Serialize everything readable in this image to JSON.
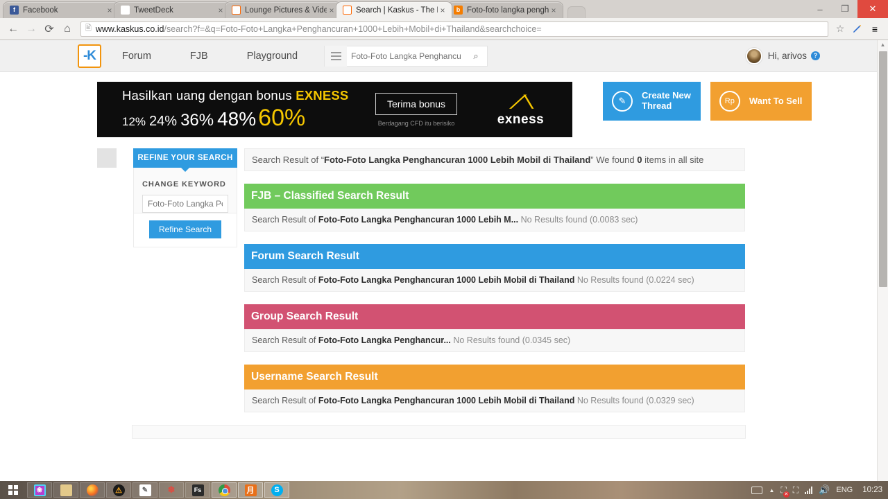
{
  "browser": {
    "tabs": [
      {
        "title": "Facebook",
        "favicon": "facebook-icon",
        "glyph": "f",
        "active": false
      },
      {
        "title": "TweetDeck",
        "favicon": "twitter-icon",
        "glyph": "▼",
        "active": false
      },
      {
        "title": "Lounge Pictures & Video",
        "favicon": "kaskus-icon",
        "glyph": "K",
        "active": false
      },
      {
        "title": "Search | Kaskus - The Larg",
        "favicon": "kaskus-icon",
        "glyph": "K",
        "active": true
      },
      {
        "title": "Foto-foto langka penghan",
        "favicon": "blogger-icon",
        "glyph": "b",
        "active": false
      }
    ],
    "tab_close_label": "×",
    "window": {
      "minimize": "–",
      "restore": "❐",
      "close": "✕"
    },
    "nav": {
      "back": "←",
      "forward": "→",
      "reload": "⟳",
      "home": "⌂"
    },
    "url_host": "www.kaskus.co.id",
    "url_path": "/search?f=&q=Foto-Foto+Langka+Penghancuran+1000+Lebih+Mobil+di+Thailand&searchchoice=",
    "page_icon": "὜B",
    "bookmark_icon": "☆",
    "edit_icon": "✎",
    "menu_icon": "≡"
  },
  "site_header": {
    "logo_text": "-K",
    "nav": [
      {
        "label": "Forum"
      },
      {
        "label": "FJB"
      },
      {
        "label": "Playground"
      }
    ],
    "search_value": "Foto-Foto Langka Penghancur",
    "search_placeholder": "Foto-Foto Langka Penghancur",
    "search_icon": "⌕",
    "user_greeting": "Hi, arivos",
    "help_badge": "?"
  },
  "banner": {
    "headline_prefix": "Hasilkan uang dengan bonus ",
    "headline_brand": "EXNESS",
    "percents": [
      "12%",
      "24%",
      "36%",
      "48%",
      "60%"
    ],
    "cta": "Terima bonus",
    "disclaimer": "Berdagang CFD itu berisiko",
    "logo_mark": "⟋⟍",
    "logo_name": "exness"
  },
  "action_buttons": [
    {
      "name": "create-new-thread",
      "icon": "pencil-icon",
      "glyph": "✎",
      "label": "Create New\nThread",
      "line1": "Create New",
      "line2": "Thread",
      "color": "#2f9be0"
    },
    {
      "name": "want-to-sell",
      "icon": "rupiah-icon",
      "glyph": "Rp",
      "label": "Want To Sell",
      "line1": "Want To Sell",
      "line2": "",
      "color": "#f2a030"
    }
  ],
  "refine_panel": {
    "tab_label": "REFINE YOUR SEARCH",
    "section_label": "CHANGE KEYWORD",
    "input_value": "Foto-Foto Langka Pe",
    "input_placeholder": "Foto-Foto Langka Pe",
    "button_label": "Refine Search"
  },
  "results": {
    "summary_prefix": "Search Result of “",
    "summary_query": "Foto-Foto Langka Penghancuran 1000 Lebih Mobil di Thailand",
    "summary_mid": "” We found ",
    "summary_count": "0",
    "summary_suffix": " items in all site",
    "blocks": [
      {
        "title": "FJB – Classified Search Result",
        "color": "#71ca5c",
        "body_prefix": "Search Result of ",
        "body_query": "Foto-Foto Langka Penghancuran 1000 Lebih M...",
        "body_status": "No Results found (0.0083 sec)"
      },
      {
        "title": "Forum Search Result",
        "color": "#2f9be0",
        "body_prefix": "Search Result of ",
        "body_query": "Foto-Foto Langka Penghancuran 1000 Lebih Mobil di Thailand",
        "body_status": "No Results found (0.0224 sec)"
      },
      {
        "title": "Group Search Result",
        "color": "#d25272",
        "body_prefix": "Search Result of ",
        "body_query": "Foto-Foto Langka Penghancur...",
        "body_status": "No Results found (0.0345 sec)"
      },
      {
        "title": "Username Search Result",
        "color": "#f2a030",
        "body_prefix": "Search Result of ",
        "body_query": "Foto-Foto Langka Penghancuran 1000 Lebih Mobil di Thailand",
        "body_status": "No Results found (0.0329 sec)"
      }
    ]
  },
  "taskbar": {
    "start": "windows-start-icon",
    "items": [
      {
        "name": "taskbar-item-photo-app",
        "glyph": "❀",
        "running": false
      },
      {
        "name": "taskbar-item-file-explorer",
        "glyph": "▧",
        "running": false
      },
      {
        "name": "taskbar-item-firefox",
        "glyph": "",
        "running": false
      },
      {
        "name": "taskbar-item-warning-app",
        "glyph": "⚠",
        "running": false
      },
      {
        "name": "taskbar-item-notepad",
        "glyph": "✎",
        "running": false
      },
      {
        "name": "taskbar-item-red-app",
        "glyph": "❄",
        "running": false
      },
      {
        "name": "taskbar-item-fireworks",
        "glyph": "Fs",
        "running": false
      },
      {
        "name": "taskbar-item-chrome",
        "glyph": "",
        "running": true
      },
      {
        "name": "taskbar-item-orange-app",
        "glyph": "月",
        "running": true
      },
      {
        "name": "taskbar-item-skype",
        "glyph": "S",
        "running": true
      }
    ],
    "tray": {
      "keyboard": "keyboard-icon",
      "show_hidden": "▲",
      "network": "὚7",
      "network_error": "✕",
      "battery": "ὐb",
      "signal": "signal-icon",
      "volume": "ὐa",
      "language": "ENG",
      "clock": "10:23"
    }
  }
}
